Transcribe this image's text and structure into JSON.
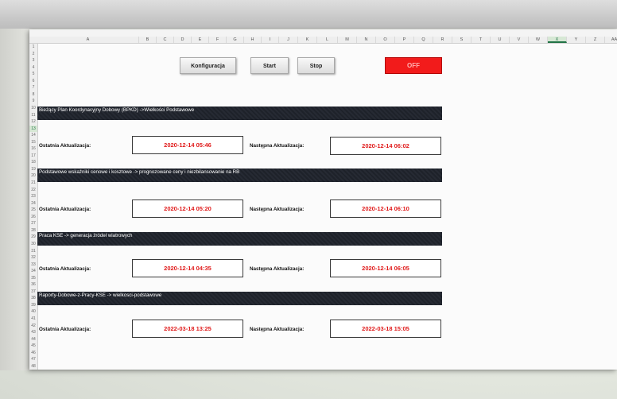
{
  "columns": [
    "A",
    "B",
    "C",
    "D",
    "E",
    "F",
    "G",
    "H",
    "I",
    "J",
    "K",
    "L",
    "M",
    "N",
    "O",
    "P",
    "Q",
    "R",
    "S",
    "T",
    "U",
    "V",
    "W",
    "X",
    "Y",
    "Z",
    "AA"
  ],
  "selected_column": "X",
  "selected_row": "13",
  "toolbar": {
    "config_label": "Konfiguracja",
    "start_label": "Start",
    "stop_label": "Stop",
    "status_label": "OFF"
  },
  "sections": [
    {
      "title": "Bieżący Plan Koordynacyjny Dobowy (BPKD) ->Wielkości Podstawowe",
      "last_label": "Ostatnia Aktualizacja:",
      "last_value": "2020-12-14 05:46",
      "next_label": "Następna Aktualizacja:",
      "next_value": "2020-12-14 06:02"
    },
    {
      "title": "Podstawowe wskaźniki cenowe i kosztowe -> prognozowane ceny i niezbilansowanie na RB",
      "last_label": "Ostatnia Aktualizacja:",
      "last_value": "2020-12-14 05:20",
      "next_label": "Następna Aktualizacja:",
      "next_value": "2020-12-14 06:10"
    },
    {
      "title": "Praca KSE -> generacja źródeł wiatrowych",
      "last_label": "Ostatnia Aktualizacja:",
      "last_value": "2020-12-14 04:35",
      "next_label": "Następna Aktualizacja:",
      "next_value": "2020-12-14 06:05"
    },
    {
      "title": "Raporty-Dobowe-z-Pracy-KSE -> wielkosci-podstawowe",
      "last_label": "Ostatnia Aktualizacja:",
      "last_value": "2022-03-18 13:25",
      "next_label": "Następna Aktualizacja:",
      "next_value": "2022-03-18 15:05"
    }
  ],
  "colors": {
    "off_button": "#f21b1b",
    "date_text": "#e01a1a",
    "section_bar": "#262a33",
    "selection_accent": "#217346"
  }
}
